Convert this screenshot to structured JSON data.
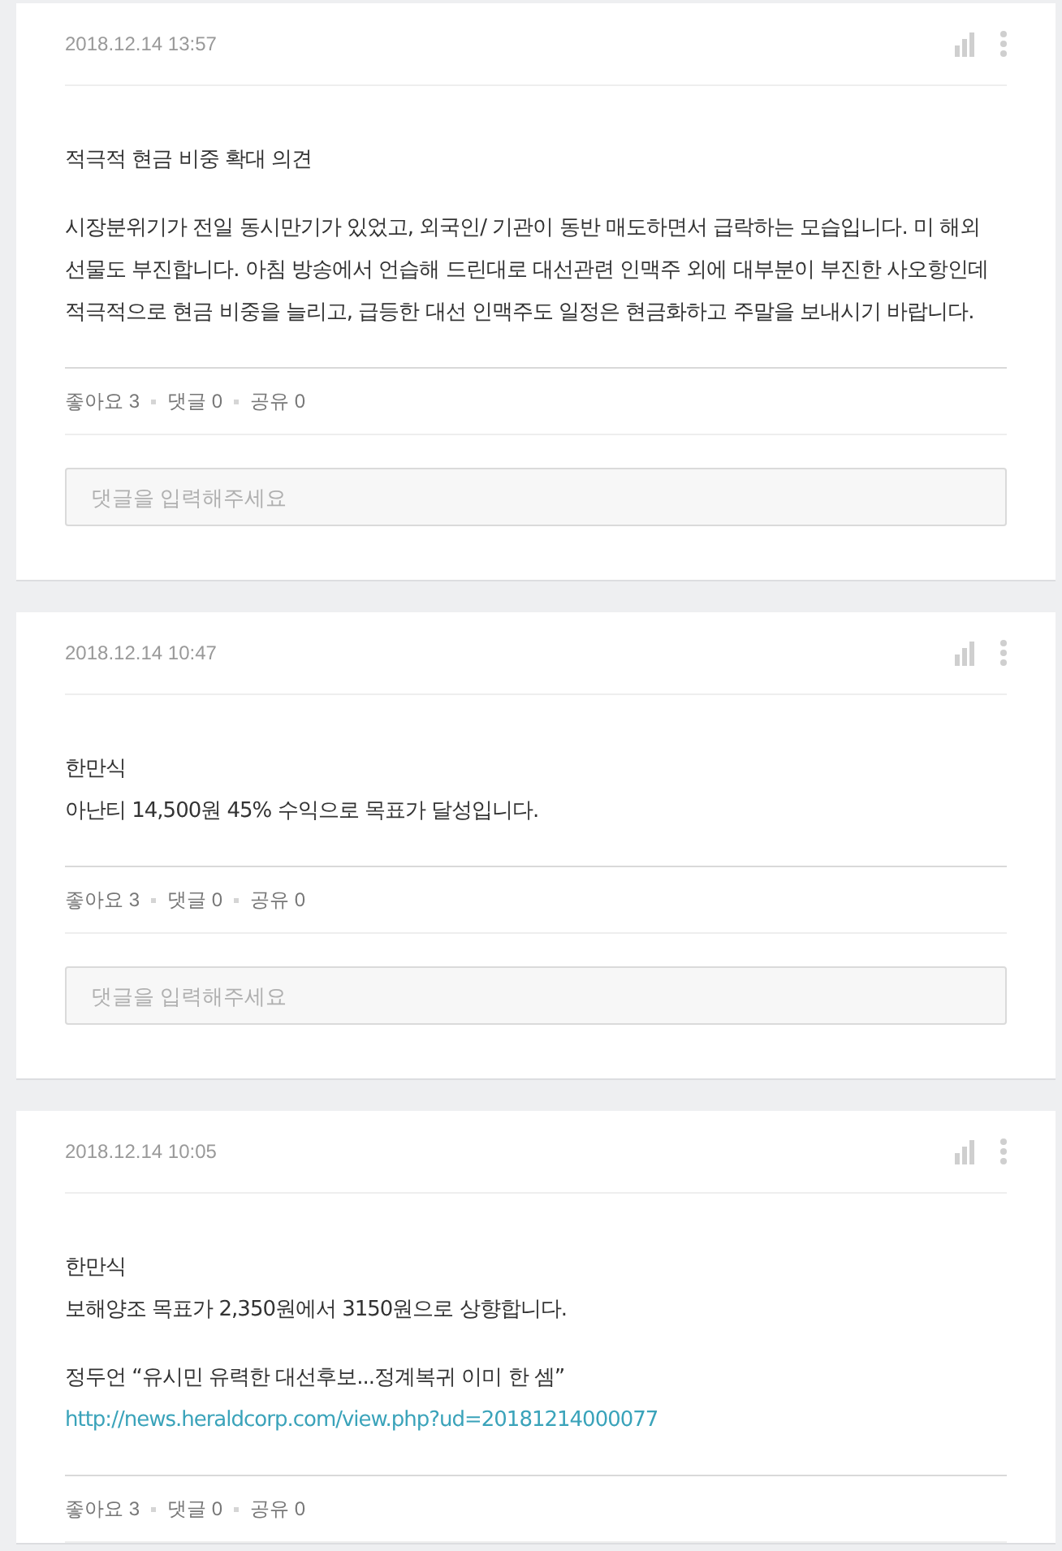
{
  "posts": [
    {
      "date": "2018.12.14 13:57",
      "body": [
        [
          {
            "kind": "text",
            "text": "적극적 현금 비중 확대 의견"
          }
        ],
        [
          {
            "kind": "text",
            "text": "시장분위기가 전일 동시만기가 있었고, 외국인/ 기관이 동반 매도하면서 급락하는 모습입니다. 미 해외 선물도 부진합니다. 아침 방송에서 언습해 드린대로 대선관련 인맥주 외에 대부분이 부진한 사오항인데 적극적으로 현금 비중을 늘리고, 급등한 대선 인맥주도 일정은 현금화하고 주말을 보내시기 바랍니다."
          }
        ]
      ],
      "stats": [
        "좋아요 3",
        "댓글 0",
        "공유 0"
      ],
      "comment": {
        "placeholder": "댓글을 입력해주세요"
      }
    },
    {
      "date": "2018.12.14 10:47",
      "body": [
        [
          {
            "kind": "text",
            "text": "한만식"
          },
          {
            "kind": "text",
            "text": "아난티 14,500원 45% 수익으로 목표가 달성입니다."
          }
        ]
      ],
      "stats": [
        "좋아요 3",
        "댓글 0",
        "공유 0"
      ],
      "comment": {
        "placeholder": "댓글을 입력해주세요"
      }
    },
    {
      "date": "2018.12.14 10:05",
      "body": [
        [
          {
            "kind": "text",
            "text": "한만식"
          },
          {
            "kind": "text",
            "text": "보해양조 목표가 2,350원에서 3150원으로 상향합니다."
          }
        ],
        [
          {
            "kind": "text",
            "text": "정두언 “유시민 유력한 대선후보...정계복귀 이미 한 셈”"
          },
          {
            "kind": "link",
            "text": "http://news.heraldcorp.com/view.php?ud=20181214000077"
          }
        ]
      ],
      "stats": [
        "좋아요 3",
        "댓글 0",
        "공유 0"
      ]
    }
  ]
}
